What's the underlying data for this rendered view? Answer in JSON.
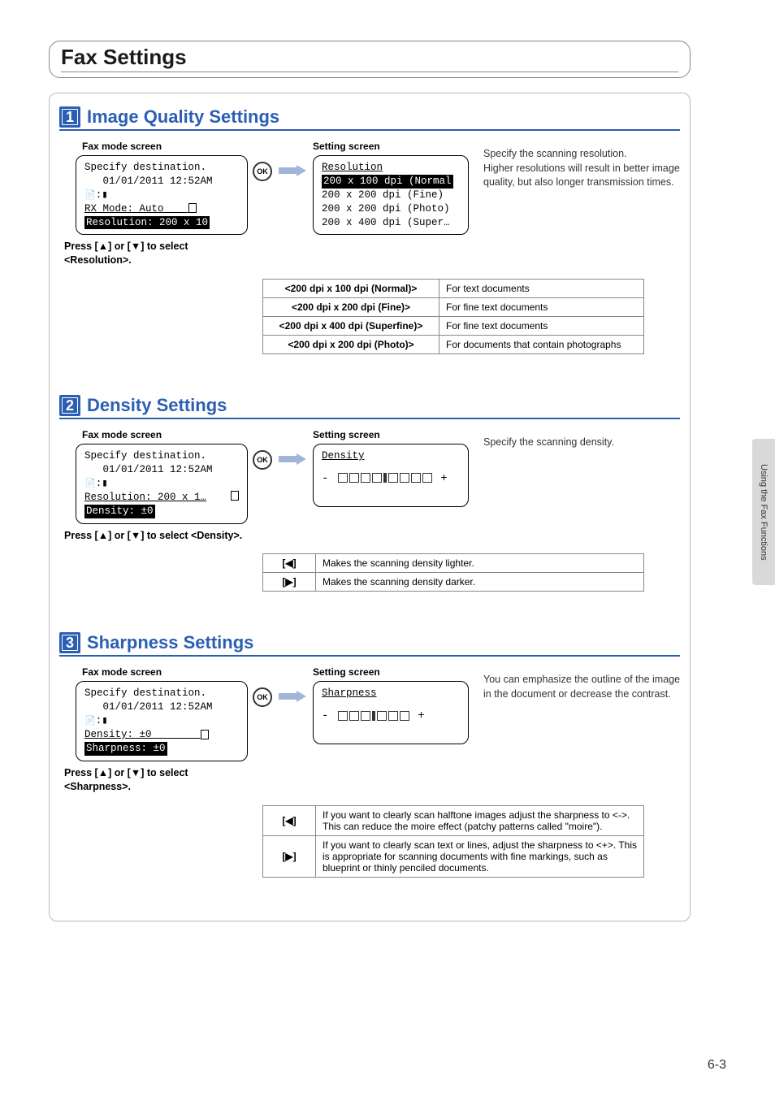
{
  "page": {
    "title": "Fax Settings",
    "number": "6-3",
    "sideTab": "Using the Fax Functions"
  },
  "labels": {
    "faxModeScreen": "Fax mode screen",
    "settingScreen": "Setting screen",
    "ok": "OK"
  },
  "section1": {
    "step": "1",
    "title": "Image Quality Settings",
    "fax": {
      "l1": "Specify destination.",
      "l2": "   01/01/2011 12:52AM",
      "l4": "RX Mode: Auto",
      "l5": "Resolution: 200 x 10"
    },
    "setting": {
      "title": "Resolution",
      "o1": "200 x 100 dpi (Normal",
      "o2": "200 x 200 dpi (Fine)",
      "o3": "200 x 200 dpi (Photo)",
      "o4": "200 x 400 dpi (Super…"
    },
    "desc1": "Specify the scanning resolution.",
    "desc2": "Higher resolutions will result in better image quality, but also longer transmission times.",
    "instr": "Press [▲] or [▼] to select <Resolution>.",
    "tbl": {
      "r1a": "<200 dpi x 100 dpi (Normal)>",
      "r1b": "For text documents",
      "r2a": "<200 dpi x 200 dpi (Fine)>",
      "r2b": "For fine text documents",
      "r3a": "<200 dpi x 400 dpi (Superfine)>",
      "r3b": "For fine text documents",
      "r4a": "<200 dpi x 200 dpi (Photo)>",
      "r4b": "For documents that contain photographs"
    }
  },
  "section2": {
    "step": "2",
    "title": "Density Settings",
    "fax": {
      "l1": "Specify destination.",
      "l2": "   01/01/2011 12:52AM",
      "l4": "Resolution: 200 x 1…",
      "l5": "Density: ±0"
    },
    "setting": {
      "title": "Density"
    },
    "desc": "Specify the scanning density.",
    "instr": "Press [▲] or [▼] to select <Density>.",
    "tbl": {
      "r1a": "[◀]",
      "r1b": "Makes the scanning density lighter.",
      "r2a": "[▶]",
      "r2b": "Makes the scanning density darker."
    }
  },
  "section3": {
    "step": "3",
    "title": "Sharpness Settings",
    "fax": {
      "l1": "Specify destination.",
      "l2": "   01/01/2011 12:52AM",
      "l4": "Density: ±0",
      "l5": "Sharpness: ±0"
    },
    "setting": {
      "title": "Sharpness"
    },
    "desc": "You can emphasize the outline of the image in the document or decrease the contrast.",
    "instr": "Press [▲] or [▼] to select <Sharpness>.",
    "tbl": {
      "r1a": "[◀]",
      "r1b": "If you want to clearly scan halftone images adjust the sharpness to <->. This can reduce the moire effect (patchy patterns called \"moire\").",
      "r2a": "[▶]",
      "r2b": "If you want to clearly scan text or lines, adjust the sharpness to <+>. This is appropriate for scanning documents with fine markings, such as blueprint or thinly penciled documents."
    }
  }
}
